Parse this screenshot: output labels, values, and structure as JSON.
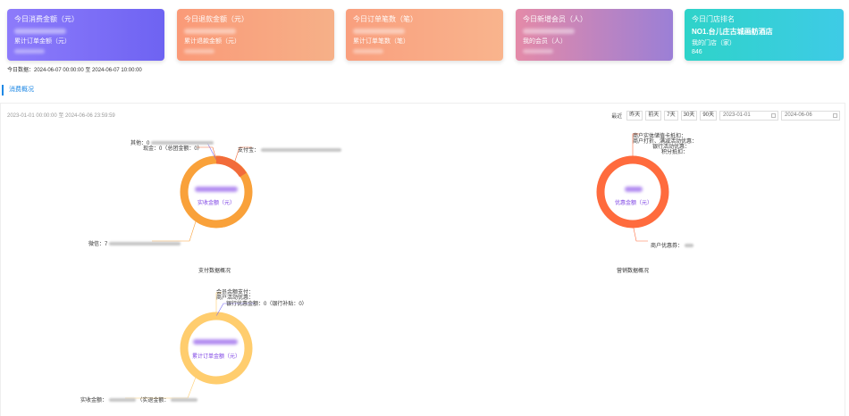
{
  "cards": [
    {
      "title": "今日消费金额（元）",
      "sub": "累计订单金额（元）",
      "color": "#7b6cf6"
    },
    {
      "title": "今日退款金额（元）",
      "sub": "累计退款金额（元）",
      "color": "#f7926e"
    },
    {
      "title": "今日订单笔数（笔）",
      "sub": "累计订单笔数（笔）",
      "color": "#f9a47f"
    },
    {
      "title": "今日新增会员（人）",
      "sub": "我的会员（人）",
      "color": "#c57fc1"
    },
    {
      "title": "今日门店排名",
      "store": "NO1.台儿庄古城画舫酒店",
      "sub": "我的门店（家）",
      "count": "846",
      "color": "#2fd0d6"
    }
  ],
  "stats_time": "今日数据：2024-06-07 00:00:00 至 2024-06-07 10:00:00",
  "section_title": "消费概况",
  "range_text": "2023-01-01 00:00:00 至 2024-06-06 23:59:59",
  "filter": {
    "label": "最近",
    "buttons": [
      "昨天",
      "前天",
      "7天",
      "30天",
      "90天"
    ],
    "start_date": "2023-01-01",
    "end_date": "2024-06-06"
  },
  "charts": [
    {
      "center_label": "实收金额（元）",
      "title": "支付数据概况",
      "labels": [
        "其他：0",
        "现金：0（总团金额：0）",
        "支付宝：",
        "微信：7"
      ],
      "ring_color": "#f9a13a",
      "accent_color": "#f26b3a"
    },
    {
      "center_label": "优惠金额（元）",
      "title": "营销数据概况",
      "labels": [
        "商户实体储值卡抵扣：",
        "商户打折、满减活动优惠：",
        "银行活动优惠：",
        "积分抵扣：",
        "商户优惠券："
      ],
      "ring_color": "#ff6b3d"
    },
    {
      "center_label": "累计订单金额（元）",
      "title": "",
      "labels": [
        "会员余额支付：",
        "商户活动优惠：",
        "银行优惠金额：0（银行补贴：0）",
        "实收金额：",
        "（实退金额："
      ],
      "ring_color": "#ffcd6e"
    }
  ]
}
